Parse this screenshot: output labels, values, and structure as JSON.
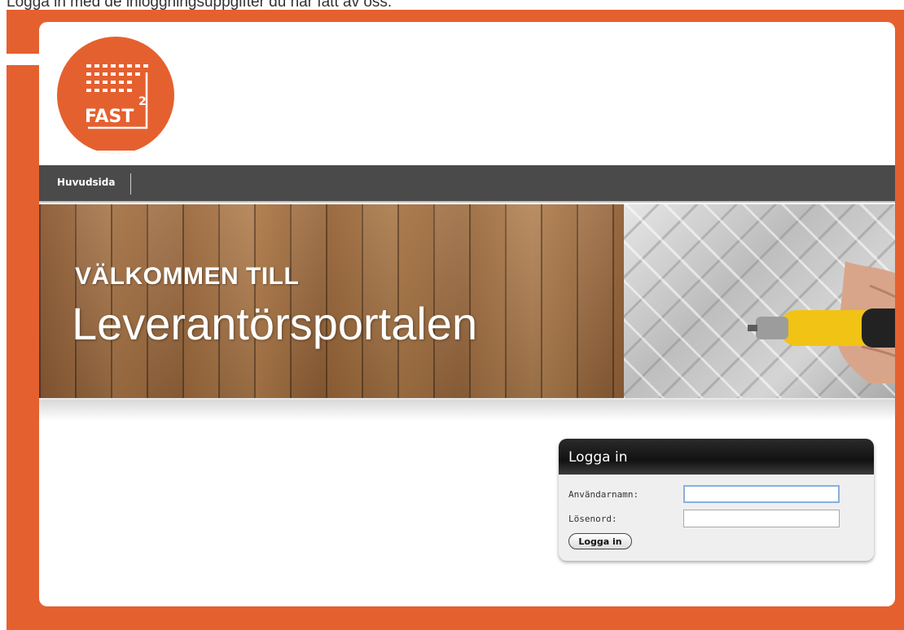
{
  "caption": "Logga in med de inloggningsuppgifter du har fått av oss.",
  "logo": {
    "text": "FAST",
    "superscript": "2"
  },
  "nav": {
    "items": [
      {
        "label": "Huvudsida"
      }
    ]
  },
  "banner": {
    "welcome_line": "VÄLKOMMEN TILL",
    "portal_name": "Leverantörsportalen"
  },
  "login": {
    "title": "Logga in",
    "username_label": "Användarnamn:",
    "username_value": "",
    "password_label": "Lösenord:",
    "password_value": "",
    "submit_label": "Logga in"
  },
  "colors": {
    "brand": "#e5602f",
    "nav_bg": "#4a4a4a"
  }
}
